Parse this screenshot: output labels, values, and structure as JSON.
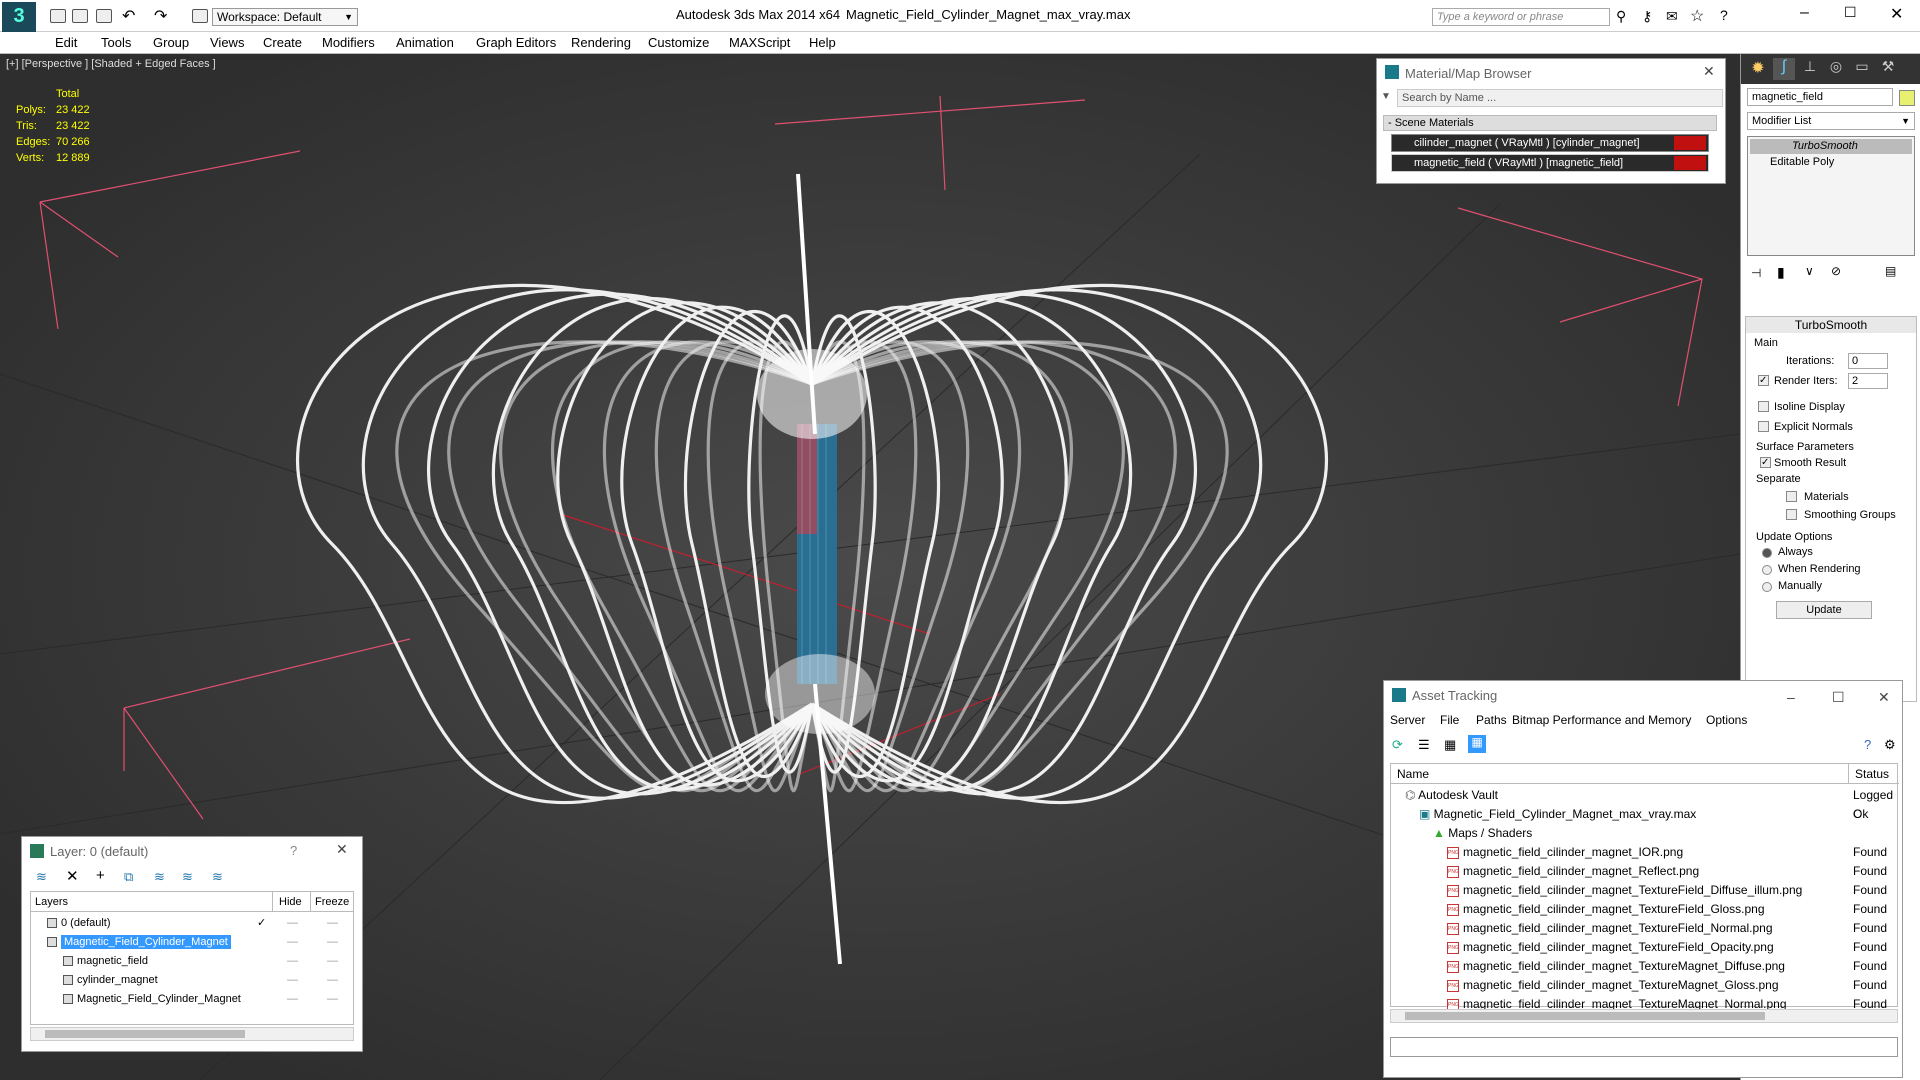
{
  "titlebar": {
    "workspace": "Workspace: Default",
    "app_title": "Autodesk 3ds Max  2014 x64",
    "file_title": "Magnetic_Field_Cylinder_Magnet_max_vray.max",
    "search_placeholder": "Type a keyword or phrase"
  },
  "menu": [
    "Edit",
    "Tools",
    "Group",
    "Views",
    "Create",
    "Modifiers",
    "Animation",
    "Graph Editors",
    "Rendering",
    "Customize",
    "MAXScript",
    "Help"
  ],
  "viewport": {
    "label": "[+] [Perspective ] [Shaded + Edged Faces ]",
    "stats": {
      "total_label": "Total",
      "polys_label": "Polys:",
      "polys": "23 422",
      "tris_label": "Tris:",
      "tris": "23 422",
      "edges_label": "Edges:",
      "edges": "70 266",
      "verts_label": "Verts:",
      "verts": "12 889"
    }
  },
  "material_browser": {
    "title": "Material/Map Browser",
    "search_placeholder": "Search by Name ...",
    "section": "- Scene Materials",
    "items": [
      "cilinder_magnet  ( VRayMtl ) [cylinder_magnet]",
      "magnetic_field  ( VRayMtl ) [magnetic_field]"
    ]
  },
  "command_panel": {
    "object_name": "magnetic_field",
    "modifier_list": "Modifier List",
    "stack": [
      "TurboSmooth",
      "Editable Poly"
    ],
    "rollout_title": "TurboSmooth",
    "main": "Main",
    "iterations_label": "Iterations:",
    "iterations": "0",
    "render_iters_label": "Render Iters:",
    "render_iters": "2",
    "isoline": "Isoline Display",
    "explicit": "Explicit Normals",
    "surface": "Surface Parameters",
    "smooth_result": "Smooth Result",
    "separate": "Separate",
    "materials": "Materials",
    "smoothing": "Smoothing Groups",
    "update_options": "Update Options",
    "always": "Always",
    "when_rendering": "When Rendering",
    "manually": "Manually",
    "update_btn": "Update"
  },
  "asset_tracking": {
    "title": "Asset Tracking",
    "menu": [
      "Server",
      "File",
      "Paths",
      "Bitmap Performance and Memory",
      "Options"
    ],
    "col_name": "Name",
    "col_status": "Status",
    "rows": [
      {
        "name": "Autodesk Vault",
        "status": "Logged C",
        "indent": 1
      },
      {
        "name": "Magnetic_Field_Cylinder_Magnet_max_vray.max",
        "status": "Ok",
        "indent": 2
      },
      {
        "name": "Maps / Shaders",
        "status": "",
        "indent": 3
      },
      {
        "name": "magnetic_field_cilinder_magnet_IOR.png",
        "status": "Found",
        "indent": 4
      },
      {
        "name": "magnetic_field_cilinder_magnet_Reflect.png",
        "status": "Found",
        "indent": 4
      },
      {
        "name": "magnetic_field_cilinder_magnet_TextureField_Diffuse_illum.png",
        "status": "Found",
        "indent": 4
      },
      {
        "name": "magnetic_field_cilinder_magnet_TextureField_Gloss.png",
        "status": "Found",
        "indent": 4
      },
      {
        "name": "magnetic_field_cilinder_magnet_TextureField_Normal.png",
        "status": "Found",
        "indent": 4
      },
      {
        "name": "magnetic_field_cilinder_magnet_TextureField_Opacity.png",
        "status": "Found",
        "indent": 4
      },
      {
        "name": "magnetic_field_cilinder_magnet_TextureMagnet_Diffuse.png",
        "status": "Found",
        "indent": 4
      },
      {
        "name": "magnetic_field_cilinder_magnet_TextureMagnet_Gloss.png",
        "status": "Found",
        "indent": 4
      },
      {
        "name": "magnetic_field_cilinder_magnet_TextureMagnet_Normal.png",
        "status": "Found",
        "indent": 4
      }
    ]
  },
  "layers": {
    "title": "Layer: 0 (default)",
    "help": "?",
    "col_layers": "Layers",
    "col_hide": "Hide",
    "col_freeze": "Freeze",
    "rows": [
      {
        "name": "0 (default)",
        "indent": 1
      },
      {
        "name": "Magnetic_Field_Cylinder_Magnet",
        "indent": 1
      },
      {
        "name": "magnetic_field",
        "indent": 2
      },
      {
        "name": "cylinder_magnet",
        "indent": 2
      },
      {
        "name": "Magnetic_Field_Cylinder_Magnet",
        "indent": 2
      }
    ]
  },
  "colors": {
    "accent": "#3399ff",
    "viewport_bg": "#3b3b3b",
    "wire": "#ffffff",
    "grid": "#e05070",
    "magnet": "#3a8fc0"
  }
}
